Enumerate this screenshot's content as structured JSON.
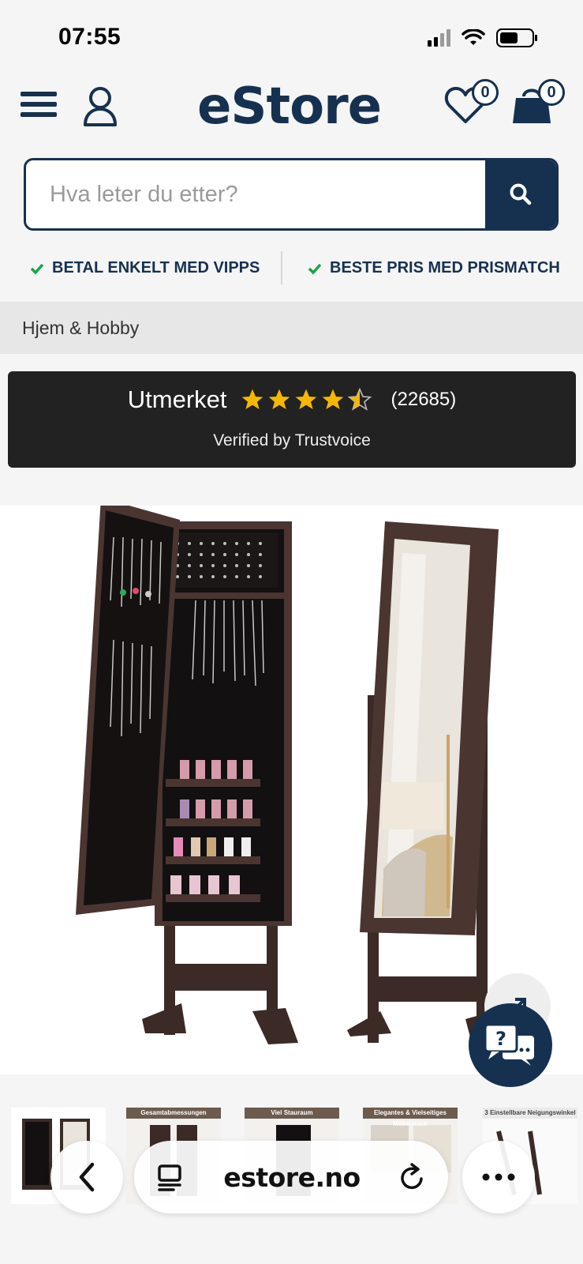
{
  "status": {
    "time": "07:55"
  },
  "header": {
    "logo": "eStore",
    "wishlist_count": "0",
    "cart_count": "0"
  },
  "search": {
    "placeholder": "Hva leter du etter?"
  },
  "usp": [
    {
      "label": "BETAL ENKELT MED VIPPS"
    },
    {
      "label": "BESTE PRIS MED PRISMATCH"
    }
  ],
  "breadcrumb": {
    "label": "Hjem & Hobby"
  },
  "trust": {
    "label": "Utmerket",
    "rating": 4.5,
    "count": "(22685)",
    "verified": "Verified by Trustvoice"
  },
  "thumbnails": [
    {
      "caption": ""
    },
    {
      "caption": "Gesamtabmessungen"
    },
    {
      "caption": "Viel Stauraum"
    },
    {
      "caption": "Elegantes & Vielseitiges Möbelstück"
    },
    {
      "caption": "3 Einstellbare Neigungswinkel"
    }
  ],
  "browser": {
    "url": "estore.no"
  },
  "colors": {
    "brand": "#163150",
    "check": "#1aa34a",
    "star": "#f5b800",
    "trust_bg": "#222222"
  }
}
